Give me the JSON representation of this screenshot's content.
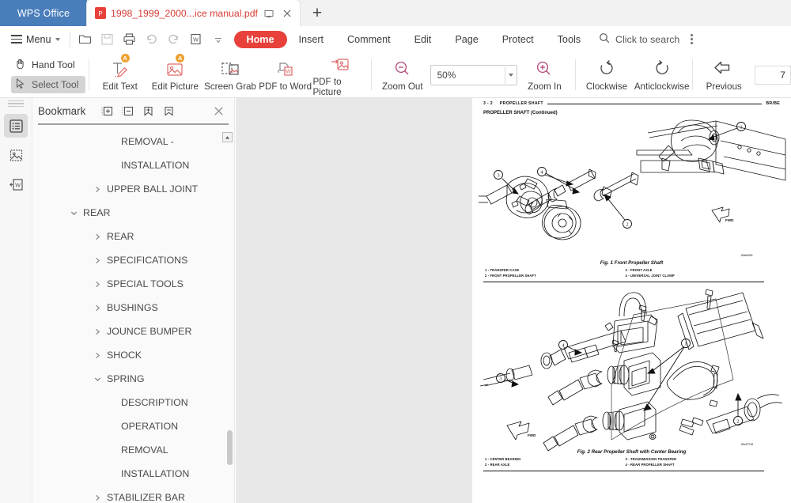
{
  "titlebar": {
    "brand": "WPS Office",
    "tab_title": "1998_1999_2000...ice manual.pdf",
    "tab_icon": "pdf-file-icon",
    "restore_icon": "restore-window-icon",
    "close_icon": "close-icon",
    "newtab_label": "+"
  },
  "menubar": {
    "menu_label": "Menu",
    "quick_icons": [
      "open-folder-icon",
      "save-icon",
      "print-icon",
      "undo-icon",
      "redo-icon",
      "export-word-icon",
      "customize-caret-icon"
    ],
    "ribbon_tabs": [
      {
        "label": "Home",
        "active": true
      },
      {
        "label": "Insert",
        "active": false
      },
      {
        "label": "Comment",
        "active": false
      },
      {
        "label": "Edit",
        "active": false
      },
      {
        "label": "Page",
        "active": false
      },
      {
        "label": "Protect",
        "active": false
      },
      {
        "label": "Tools",
        "active": false
      }
    ],
    "search_placeholder": "Click to search",
    "search_icon": "search-icon",
    "overflow_icon": "kebab-menu-icon"
  },
  "toolbar": {
    "hand_tool": "Hand Tool",
    "select_tool": "Select Tool",
    "items": [
      {
        "label": "Edit Text",
        "icon": "edit-text-icon",
        "badge": "A"
      },
      {
        "label": "Edit Picture",
        "icon": "edit-picture-icon",
        "badge": "A"
      },
      {
        "label": "Screen Grab",
        "icon": "screen-grab-icon",
        "badge": ""
      },
      {
        "label": "PDF to Word",
        "icon": "pdf-to-word-icon",
        "badge": ""
      },
      {
        "label": "PDF to Picture",
        "icon": "pdf-to-picture-icon",
        "badge": ""
      }
    ],
    "zoom_out": "Zoom Out",
    "zoom_value": "50%",
    "zoom_in": "Zoom In",
    "clockwise": "Clockwise",
    "anticlockwise": "Anticlockwise",
    "previous": "Previous",
    "page_number": "7"
  },
  "iconrail": {
    "buttons": [
      {
        "name": "bookmark-panel-icon",
        "active": true
      },
      {
        "name": "thumbnail-panel-icon",
        "active": false
      },
      {
        "name": "convert-panel-icon",
        "active": false
      }
    ]
  },
  "bookmark": {
    "title": "Bookmark",
    "tools": [
      "expand-all-icon",
      "collapse-all-icon",
      "add-bookmark-icon",
      "delete-bookmark-icon"
    ],
    "close_icon": "close-icon",
    "items": [
      {
        "label": "REMOVAL -",
        "indent": 3,
        "arrow": "none"
      },
      {
        "label": "INSTALLATION",
        "indent": 3,
        "arrow": "none"
      },
      {
        "label": "UPPER BALL JOINT",
        "indent": 2,
        "arrow": "collapsed"
      },
      {
        "label": "REAR",
        "indent": 1,
        "arrow": "expanded"
      },
      {
        "label": "REAR",
        "indent": 2,
        "arrow": "collapsed"
      },
      {
        "label": "SPECIFICATIONS",
        "indent": 2,
        "arrow": "collapsed"
      },
      {
        "label": "SPECIAL TOOLS",
        "indent": 2,
        "arrow": "collapsed"
      },
      {
        "label": "BUSHINGS",
        "indent": 2,
        "arrow": "collapsed"
      },
      {
        "label": "JOUNCE BUMPER",
        "indent": 2,
        "arrow": "collapsed"
      },
      {
        "label": "SHOCK",
        "indent": 2,
        "arrow": "collapsed"
      },
      {
        "label": "SPRING",
        "indent": 2,
        "arrow": "expanded"
      },
      {
        "label": "DESCRIPTION",
        "indent": 3,
        "arrow": "none"
      },
      {
        "label": "OPERATION",
        "indent": 3,
        "arrow": "none"
      },
      {
        "label": "REMOVAL",
        "indent": 3,
        "arrow": "none"
      },
      {
        "label": "INSTALLATION",
        "indent": 3,
        "arrow": "none"
      },
      {
        "label": "STABILIZER BAR",
        "indent": 2,
        "arrow": "collapsed"
      }
    ]
  },
  "document": {
    "header_left": "3 - 2",
    "header_section": "PROPELLER SHAFT",
    "header_right": "BR/BE",
    "subheader": "PROPELLER SHAFT (Continued)",
    "fig1": {
      "caption": "Fig. 1 Front Propeller Shaft",
      "part_number": "80a91f05",
      "fwd_label": "FWD",
      "legend_left": [
        "1 - TRANSFER CASE",
        "2 - FRONT PROPELLER SHAFT"
      ],
      "legend_right": [
        "3 - FRONT AXLE",
        "4 - UNIVERSAL JOINT CLAMP"
      ],
      "callouts": [
        "1",
        "2",
        "3",
        "4"
      ]
    },
    "fig2": {
      "caption": "Fig. 2 Rear Propeller Shaft with Center Bearing",
      "part_number": "80c07726",
      "fwd_label": "FWD",
      "legend_left": [
        "1 - CENTER BEARING",
        "2 - REAR AXLE"
      ],
      "legend_right": [
        "3 - TRANSMISSION TRANSFER",
        "4 - REAR PROPELLER SHAFT"
      ],
      "callouts": [
        "1",
        "2",
        "3",
        "4"
      ]
    }
  },
  "colors": {
    "brand_blue": "#4a7ebb",
    "accent_red": "#e8403a",
    "tab_text_red": "#d63b33",
    "doc_bg": "#e8e8e8",
    "badge_orange": "#f0a030"
  }
}
